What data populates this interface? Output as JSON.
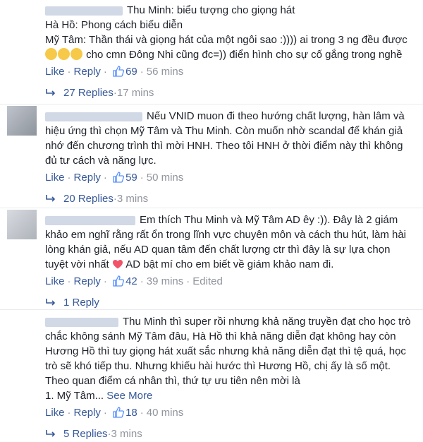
{
  "ui": {
    "like": "Like",
    "reply": "Reply",
    "dot": "·",
    "see_more": "See More",
    "edited": "Edited"
  },
  "comments": [
    {
      "author_label": "",
      "lines": [
        "Thu Minh: biểu tượng cho giọng hát",
        "Hà Hồ: Phong cách biểu diễn",
        "Mỹ Tâm: Thần thái và giọng hát của một ngôi sao :)))) ai trong 3 ng đều được",
        "cho cmn Đông Nhi cũng đc=)) điển hình cho sự cố gắng trong nghề"
      ],
      "emoji_glyph": "😌",
      "likes": "69",
      "time": "56 mins",
      "replies_label": "27 Replies",
      "replies_time": "17 mins"
    },
    {
      "author_label": "",
      "lines": [
        "Nếu VNID muon đi theo hướng chất lượng, hàn lâm và",
        "hiệu ứng thì chọn Mỹ Tâm và Thu Minh. Còn muốn nhờ scandal để khán giả",
        "nhớ đến chương trình thì mời HNH. Theo tôi HNH ở thời điểm này thì không",
        "đủ tư cách và năng lực."
      ],
      "likes": "59",
      "time": "50 mins",
      "replies_label": "20 Replies",
      "replies_time": "3 mins"
    },
    {
      "author_label": "",
      "lines": [
        "Em thích Thu Minh và Mỹ Tâm AD êy :)). Đây là 2 giám",
        "khảo em nghĩ rằng rất ổn trong lĩnh vực chuyên môn và cách thu hút, làm hài",
        "lòng khán giả, nếu AD quan tâm đến chất lượng ctr thì đây là sự lựa chọn",
        "tuyệt vời nhất",
        "AD bật mí cho em biết về giám khảo nam đi."
      ],
      "likes": "42",
      "time": "39 mins",
      "replies_label": "1 Reply"
    },
    {
      "author_label": "",
      "lines": [
        "Thu Minh thì super rồi nhưng khả năng truyền đạt cho học trò",
        "chắc không sánh Mỹ Tâm đâu, Hà Hồ thì khả năng diễn đạt không hay còn",
        "Hương Hồ thì tuy giọng hát xuất sắc nhưng khả năng diễn đạt thì tệ quá, học",
        "trò sẽ khó tiếp thu. Nhưng khiếu hài hước thì Hương Hồ, chị ấy là số một.",
        "Theo quan điểm cá nhân thì, thứ tự ưu tiên nên mời là",
        "1. Mỹ Tâm..."
      ],
      "likes": "18",
      "time": "40 mins",
      "replies_label": "5 Replies",
      "replies_time": "3 mins"
    }
  ],
  "colors": {
    "link": "#365899",
    "meta": "#90949c",
    "text": "#1d2129",
    "like_blue": "#5890ff",
    "heart": "#f25268"
  }
}
